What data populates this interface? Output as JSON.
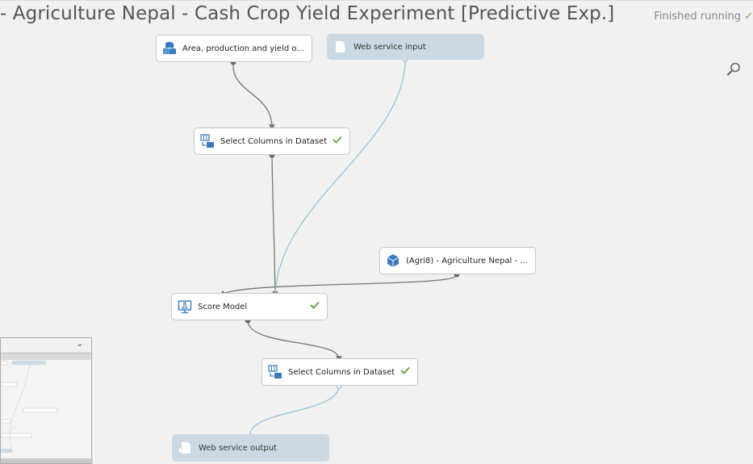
{
  "header": {
    "title": "- Agriculture Nepal - Cash Crop Yield Experiment [Predictive Exp.]",
    "status": "Finished running",
    "status_icon": "check-icon"
  },
  "canvas": {
    "search_icon": "magnifier-icon",
    "nodes": {
      "dataset": {
        "label": "Area, production and yield o...",
        "icon": "dataset-icon"
      },
      "ws_input": {
        "label": "Web service input",
        "icon": "web-service-input-icon"
      },
      "select1": {
        "label": "Select Columns in Dataset",
        "icon": "select-columns-icon",
        "status": "✓"
      },
      "trained_model": {
        "label": "(Agri8) - Agriculture Nepal - ...",
        "icon": "trained-model-icon"
      },
      "score": {
        "label": "Score Model",
        "icon": "score-model-icon",
        "status": "✓"
      },
      "select2": {
        "label": "Select Columns in Dataset",
        "icon": "select-columns-icon",
        "status": "✓"
      },
      "ws_output": {
        "label": "Web service output",
        "icon": "web-service-output-icon"
      }
    }
  },
  "minimap": {
    "toggle": "⌄",
    "toggle_icon": "chevron-down-icon"
  },
  "colors": {
    "canvas_bg": "#f1f1f1",
    "edge": "#777777",
    "ws_edge": "#8fbfd9",
    "ws_node": "#cad9e3",
    "check": "#6aa84f"
  }
}
